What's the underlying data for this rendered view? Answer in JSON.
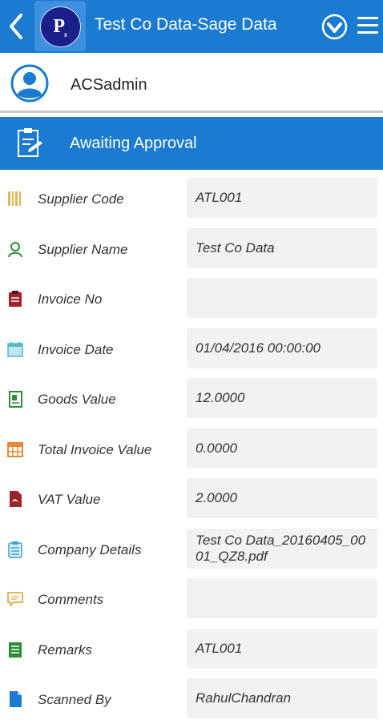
{
  "header": {
    "title": "Test Co Data-Sage Data",
    "logo_text": "P",
    "logo_sub": "s",
    "colors": {
      "bar": "#1a7bd0",
      "logo_bg": "#1b1f8a"
    },
    "icons": [
      "chevron-left-icon",
      "chevron-down-circle-icon",
      "hamburger-menu-icon"
    ]
  },
  "user": {
    "name": "ACSadmin",
    "icon": "user-avatar-icon"
  },
  "status": {
    "label": "Awaiting Approval",
    "icon": "approval-document-icon"
  },
  "fields": [
    {
      "label": "Supplier Code",
      "value": "ATL001",
      "icon": "barcode-icon"
    },
    {
      "label": "Supplier Name",
      "value": "Test Co Data",
      "icon": "person-icon"
    },
    {
      "label": "Invoice No",
      "value": "",
      "icon": "clipboard-icon"
    },
    {
      "label": "Invoice Date",
      "value": "01/04/2016 00:00:00",
      "icon": "calendar-icon"
    },
    {
      "label": "Goods Value",
      "value": "12.0000",
      "icon": "document-icon"
    },
    {
      "label": "Total Invoice Value",
      "value": "0.0000",
      "icon": "calculator-icon"
    },
    {
      "label": "VAT Value",
      "value": "2.0000",
      "icon": "pdf-file-icon"
    },
    {
      "label": "Company Details",
      "value": "Test Co Data_20160405_0001_QZ8.pdf",
      "icon": "notepad-icon"
    },
    {
      "label": "Comments",
      "value": "",
      "icon": "comment-icon"
    },
    {
      "label": "Remarks",
      "value": "ATL001",
      "icon": "list-document-icon"
    },
    {
      "label": "Scanned By",
      "value": "RahulChandran",
      "icon": "file-icon"
    }
  ]
}
